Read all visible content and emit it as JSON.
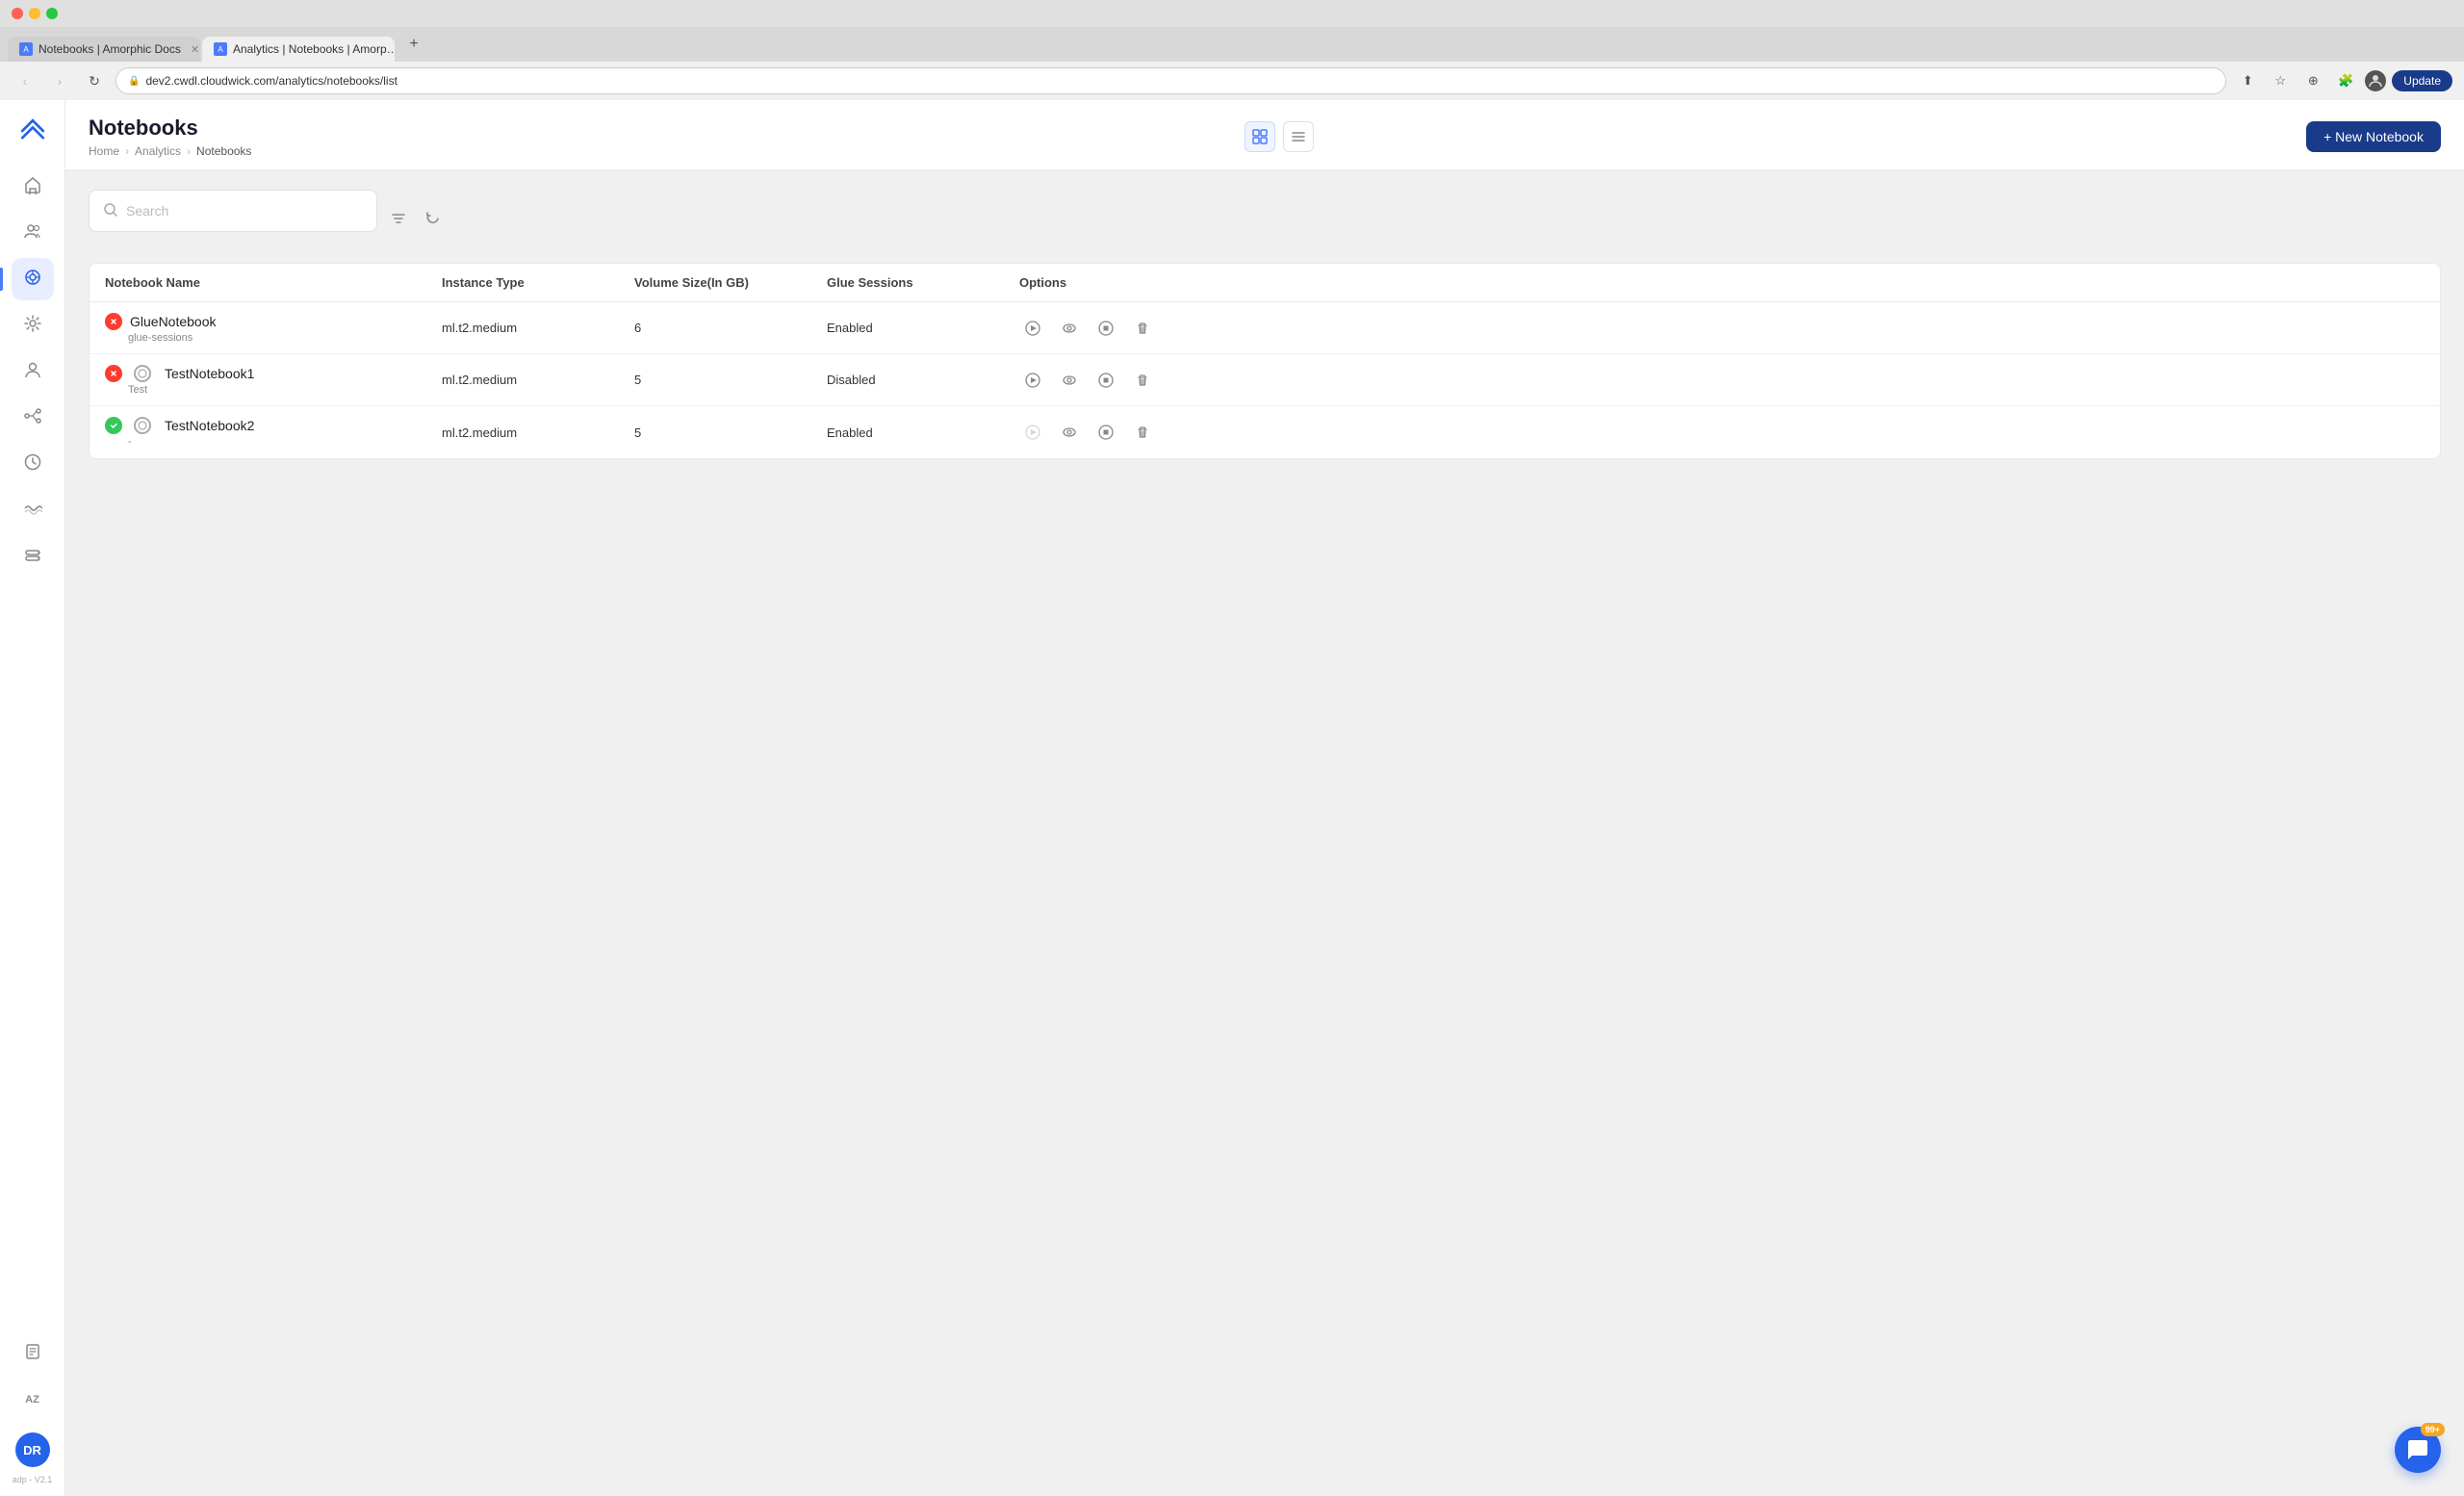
{
  "browser": {
    "tabs": [
      {
        "id": "tab1",
        "label": "Notebooks | Amorphic Docs",
        "favicon": "A",
        "active": false
      },
      {
        "id": "tab2",
        "label": "Analytics | Notebooks | Amorp…",
        "favicon": "A",
        "active": true
      }
    ],
    "add_tab_label": "+",
    "nav": {
      "back_disabled": true,
      "forward_disabled": true,
      "reload_label": "↻"
    },
    "address": "dev2.cwdl.cloudwick.com/analytics/notebooks/list",
    "update_btn_label": "Update"
  },
  "sidebar": {
    "logo_text": "A",
    "items": [
      {
        "id": "home",
        "icon": "⌂",
        "label": "Home"
      },
      {
        "id": "team",
        "icon": "👥",
        "label": "Team"
      },
      {
        "id": "analytics",
        "icon": "◎",
        "label": "Analytics",
        "active": true
      },
      {
        "id": "settings",
        "icon": "⚙",
        "label": "Settings"
      },
      {
        "id": "users",
        "icon": "👤",
        "label": "Users"
      },
      {
        "id": "pipelines",
        "icon": "⌬",
        "label": "Pipelines"
      },
      {
        "id": "clock",
        "icon": "🕐",
        "label": "Clock"
      },
      {
        "id": "waves",
        "icon": "〰",
        "label": "Waves"
      },
      {
        "id": "storage",
        "icon": "🗄",
        "label": "Storage"
      }
    ],
    "avatar": "DR",
    "version": "adp - V2.1",
    "bottom_icons": [
      {
        "id": "doc",
        "icon": "📄",
        "label": "Documentation"
      },
      {
        "id": "az",
        "icon": "AZ",
        "label": "A-Z"
      }
    ]
  },
  "page": {
    "title": "Notebooks",
    "breadcrumb": {
      "home": "Home",
      "section": "Analytics",
      "current": "Notebooks"
    },
    "new_notebook_btn": "+ New Notebook",
    "view_toggle": {
      "grid_label": "⊞",
      "list_label": "☰"
    }
  },
  "search": {
    "placeholder": "Search",
    "filter_icon": "≡",
    "refresh_icon": "↻"
  },
  "table": {
    "headers": [
      "Notebook Name",
      "Instance Type",
      "Volume Size(In GB)",
      "Glue Sessions",
      "Options"
    ],
    "rows": [
      {
        "name": "GlueNotebook",
        "tag": "glue-sessions",
        "status": "error",
        "instance_type": "ml.t2.medium",
        "volume_size": "6",
        "glue_sessions": "Enabled",
        "options": [
          "play",
          "eye",
          "stop",
          "trash"
        ]
      },
      {
        "name": "TestNotebook1",
        "tag": "Test",
        "status": "error",
        "has_circle": true,
        "instance_type": "ml.t2.medium",
        "volume_size": "5",
        "glue_sessions": "Disabled",
        "options": [
          "play",
          "eye",
          "stop",
          "trash"
        ]
      },
      {
        "name": "TestNotebook2",
        "tag": "-",
        "status": "success",
        "has_circle": true,
        "instance_type": "ml.t2.medium",
        "volume_size": "5",
        "glue_sessions": "Enabled",
        "options": [
          "play-disabled",
          "eye",
          "stop",
          "trash"
        ]
      }
    ]
  },
  "chat": {
    "icon": "💬",
    "badge": "99+"
  }
}
